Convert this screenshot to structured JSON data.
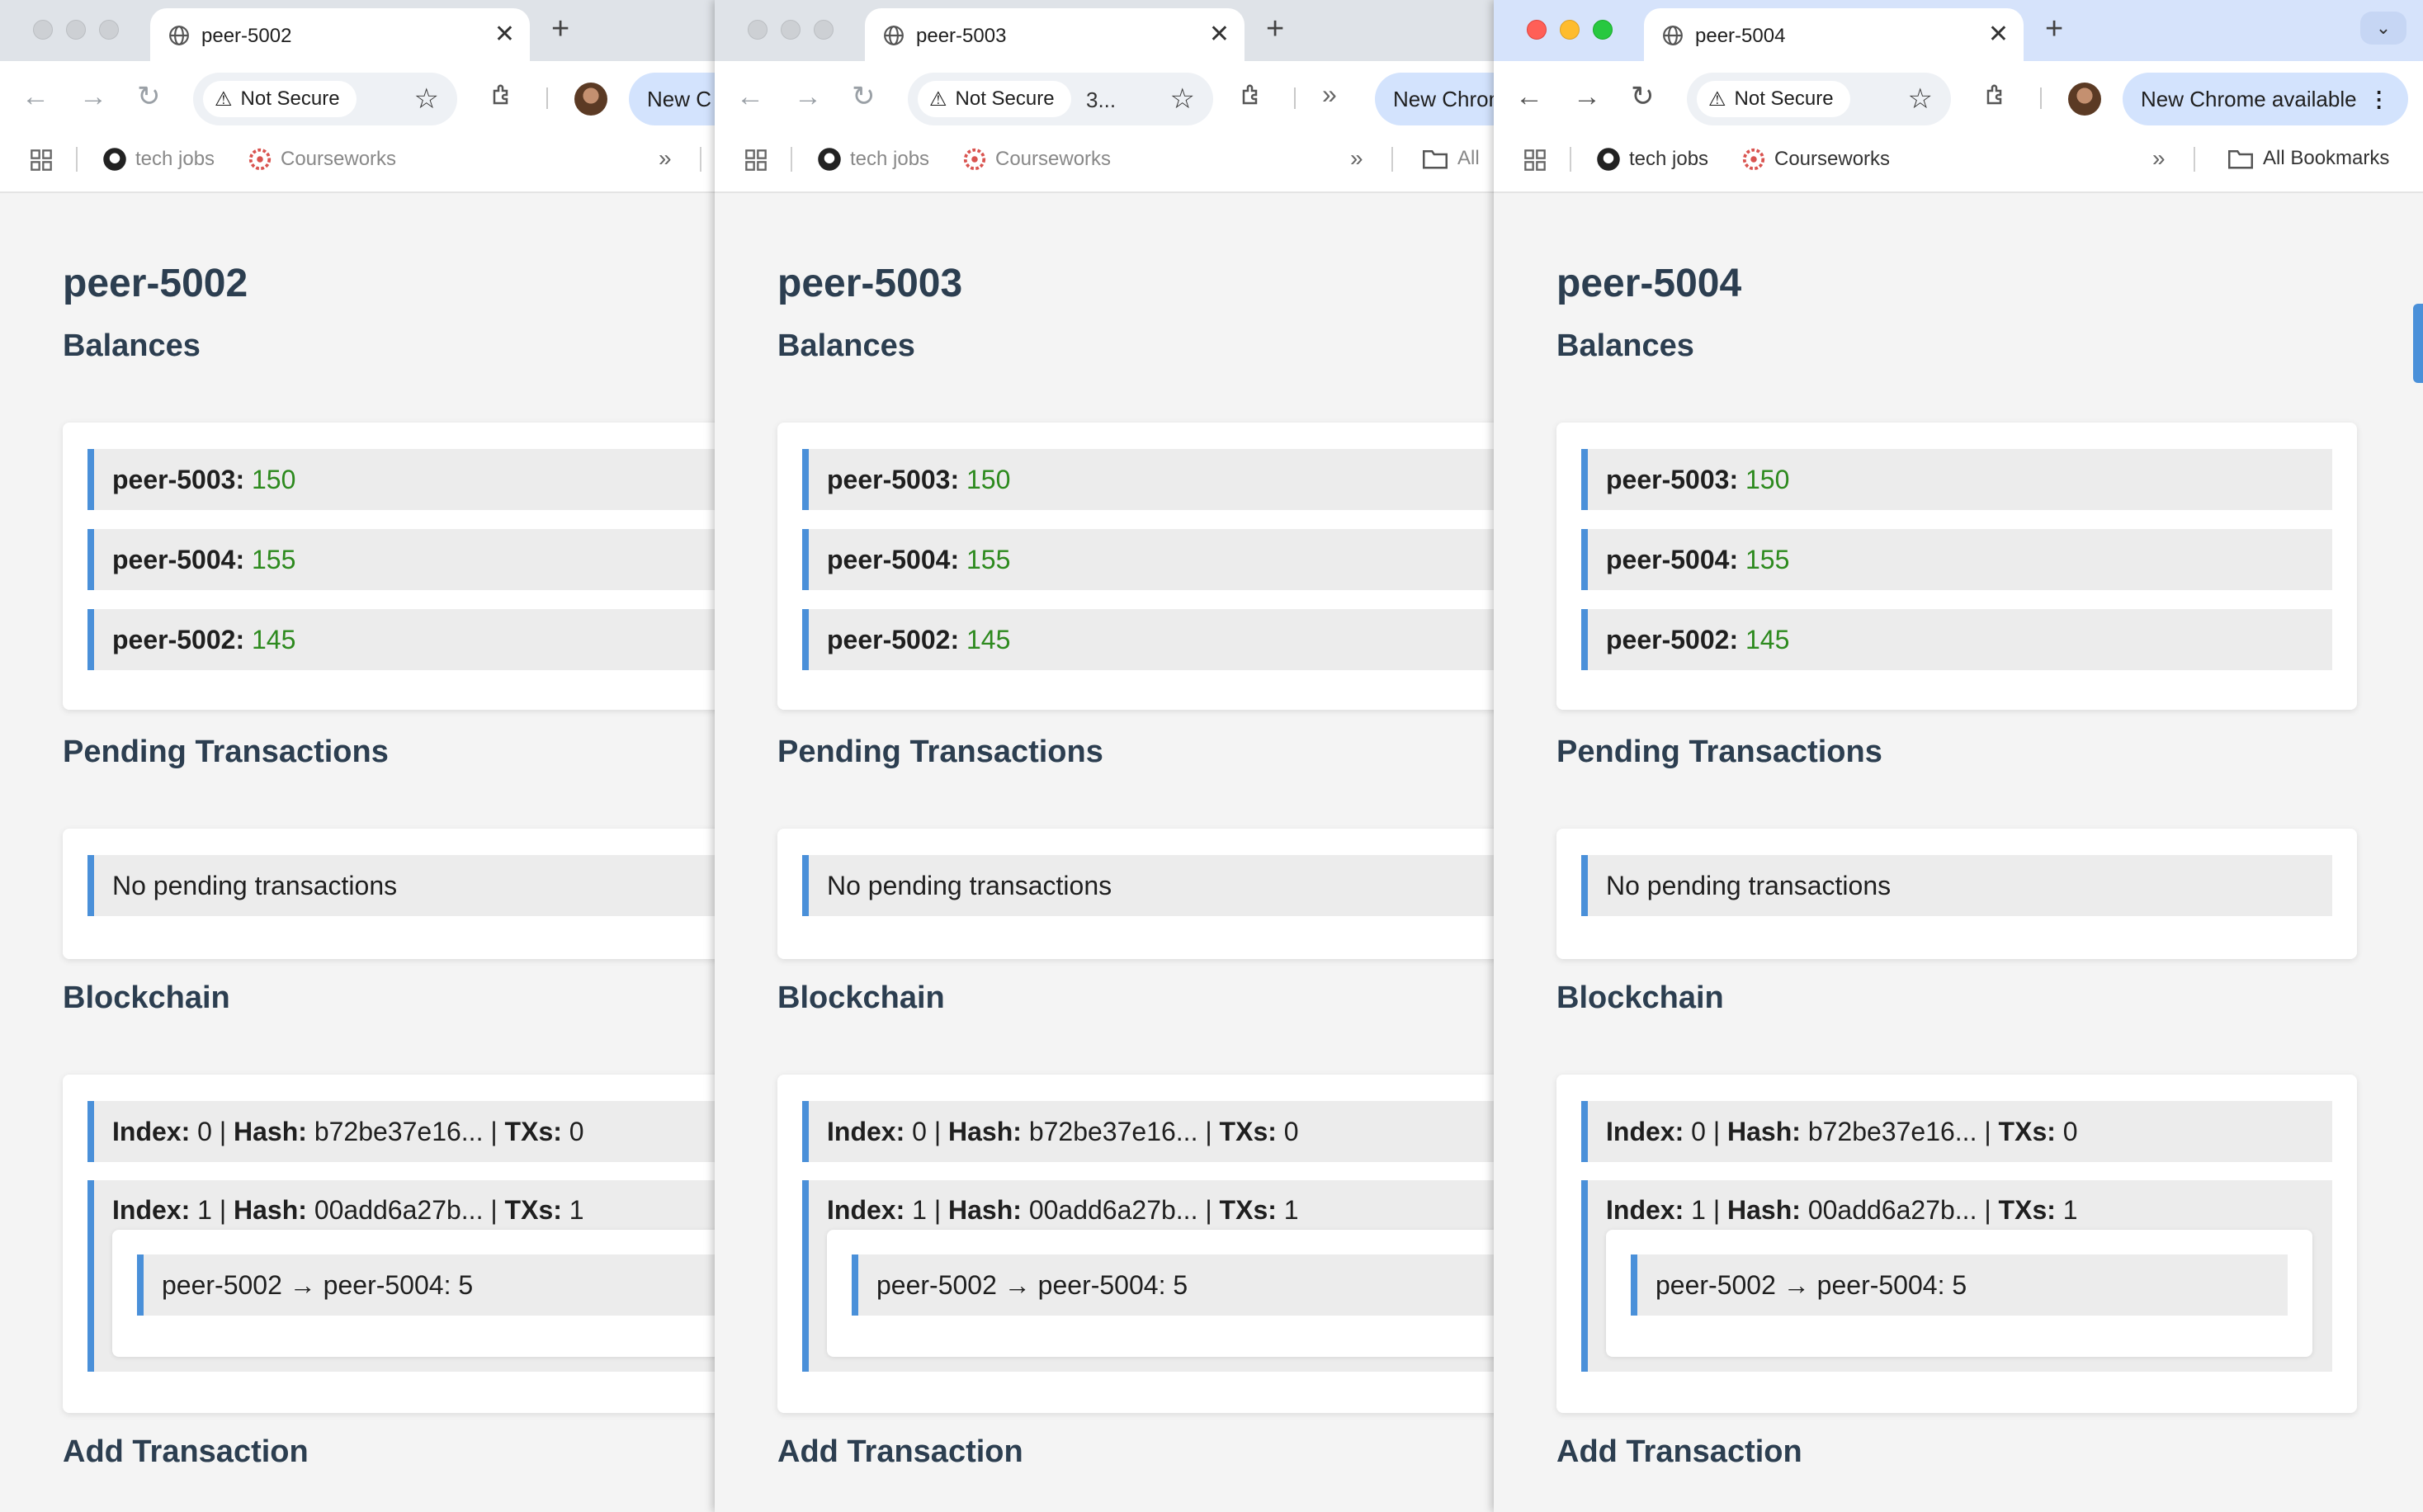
{
  "windows": [
    {
      "tab_title": "peer-5002",
      "url_fragment": "",
      "update_label": "New C",
      "all_bookmarks": "",
      "page": {
        "title": "peer-5002",
        "balances_heading": "Balances",
        "balances": [
          {
            "peer": "peer-5003:",
            "value": "150"
          },
          {
            "peer": "peer-5004:",
            "value": "155"
          },
          {
            "peer": "peer-5002:",
            "value": "145"
          }
        ],
        "pending_heading": "Pending Transactions",
        "pending_text": "No pending transactions",
        "blockchain_heading": "Blockchain",
        "blocks": [
          {
            "index": "0",
            "hash": "b72be37e16...",
            "txs": "0"
          },
          {
            "index": "1",
            "hash": "00add6a27b...",
            "txs": "1",
            "tx": "peer-5002 → peer-5004: 5"
          }
        ],
        "add_heading": "Add Transaction"
      }
    },
    {
      "tab_title": "peer-5003",
      "url_fragment": "3...",
      "update_label": "New Chrome av",
      "all_bookmarks": "All",
      "page": {
        "title": "peer-5003",
        "balances_heading": "Balances",
        "balances": [
          {
            "peer": "peer-5003:",
            "value": "150"
          },
          {
            "peer": "peer-5004:",
            "value": "155"
          },
          {
            "peer": "peer-5002:",
            "value": "145"
          }
        ],
        "pending_heading": "Pending Transactions",
        "pending_text": "No pending transactions",
        "blockchain_heading": "Blockchain",
        "blocks": [
          {
            "index": "0",
            "hash": "b72be37e16...",
            "txs": "0"
          },
          {
            "index": "1",
            "hash": "00add6a27b...",
            "txs": "1",
            "tx": "peer-5002 → peer-5004: 5"
          }
        ],
        "add_heading": "Add Transaction"
      }
    },
    {
      "tab_title": "peer-5004",
      "url_fragment": "",
      "update_label": "New Chrome available",
      "all_bookmarks": "All Bookmarks",
      "page": {
        "title": "peer-5004",
        "balances_heading": "Balances",
        "balances": [
          {
            "peer": "peer-5003:",
            "value": "150"
          },
          {
            "peer": "peer-5004:",
            "value": "155"
          },
          {
            "peer": "peer-5002:",
            "value": "145"
          }
        ],
        "pending_heading": "Pending Transactions",
        "pending_text": "No pending transactions",
        "blockchain_heading": "Blockchain",
        "blocks": [
          {
            "index": "0",
            "hash": "b72be37e16...",
            "txs": "0"
          },
          {
            "index": "1",
            "hash": "00add6a27b...",
            "txs": "1",
            "tx": "peer-5002 → peer-5004: 5"
          }
        ],
        "add_heading": "Add Transaction"
      }
    }
  ],
  "labels": {
    "not_secure": "Not Secure",
    "bookmark_tech_jobs": "tech jobs",
    "bookmark_courseworks": "Courseworks",
    "index_label": "Index:",
    "hash_label": "Hash:",
    "txs_label": "TXs:",
    "separator": "|",
    "new_tab": "+",
    "close_tab": "✕"
  },
  "colors": {
    "accent_border": "#4a90d9",
    "balance_value": "#2d8a1e",
    "heading": "#2c3e50"
  }
}
